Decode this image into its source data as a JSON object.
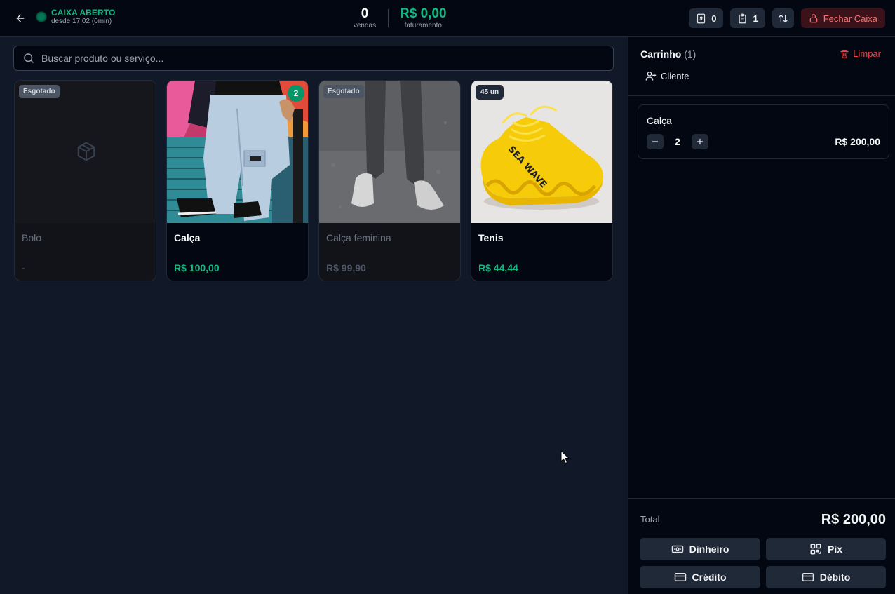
{
  "header": {
    "status_title": "CAIXA ABERTO",
    "status_sub": "desde 17:02 (0min)",
    "sales_value": "0",
    "sales_label": "vendas",
    "revenue_value": "R$ 0,00",
    "revenue_label": "faturamento",
    "counter_a": "0",
    "counter_b": "1",
    "close_label": "Fechar Caixa"
  },
  "search": {
    "placeholder": "Buscar produto ou serviço..."
  },
  "products": [
    {
      "name": "Bolo",
      "price": "-",
      "badge": "Esgotado"
    },
    {
      "name": "Calça",
      "price": "R$ 100,00",
      "count": "2"
    },
    {
      "name": "Calça feminina",
      "price": "R$ 99,90",
      "badge": "Esgotado"
    },
    {
      "name": "Tenis",
      "price": "R$ 44,44",
      "stock": "45 un",
      "brand_print": "SEA WAVE"
    }
  ],
  "cart": {
    "title": "Carrinho",
    "count": "(1)",
    "clear_label": "Limpar",
    "client_label": "Cliente",
    "items": [
      {
        "name": "Calça",
        "qty": "2",
        "price": "R$ 200,00"
      }
    ],
    "total_label": "Total",
    "total_value": "R$ 200,00"
  },
  "payment": {
    "cash": "Dinheiro",
    "pix": "Pix",
    "credit": "Crédito",
    "debit": "Débito"
  },
  "colors": {
    "accent": "#10b981",
    "danger": "#ef4444",
    "background": "#111827",
    "panel": "#030712"
  }
}
